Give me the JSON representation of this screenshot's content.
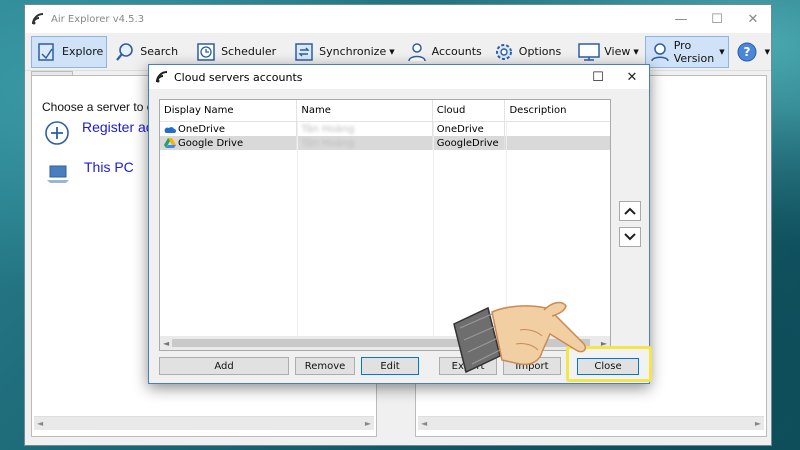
{
  "app": {
    "title": "Air Explorer v4.5.3",
    "toolbar": {
      "explore": "Explore",
      "search": "Search",
      "scheduler": "Scheduler",
      "synchronize": "Synchronize",
      "accounts": "Accounts",
      "options": "Options",
      "view": "View",
      "pro_version": "Pro Version"
    },
    "left_pane": {
      "choose_text": "Choose a server to c",
      "items": [
        {
          "label": "Register ac",
          "icon": "plus-circle-icon"
        },
        {
          "label": "This PC",
          "icon": "laptop-icon"
        }
      ]
    }
  },
  "dialog": {
    "title": "Cloud servers accounts",
    "columns": [
      "Display Name",
      "Name",
      "Cloud",
      "Description"
    ],
    "rows": [
      {
        "display_name": "OneDrive",
        "name": "Tân Hoàng",
        "cloud": "OneDrive",
        "description": "",
        "icon": "onedrive-icon",
        "selected": false
      },
      {
        "display_name": "Google Drive",
        "name": "Tân Hoàng",
        "cloud": "GoogleDrive",
        "description": "",
        "icon": "google-drive-icon",
        "selected": true
      }
    ],
    "buttons": {
      "add": "Add",
      "remove": "Remove",
      "edit": "Edit",
      "export": "Export",
      "import": "Import",
      "close": "Close"
    }
  },
  "colors": {
    "highlight": "#f4e64a",
    "link": "#1a1ae0",
    "accent": "#0078d7"
  }
}
